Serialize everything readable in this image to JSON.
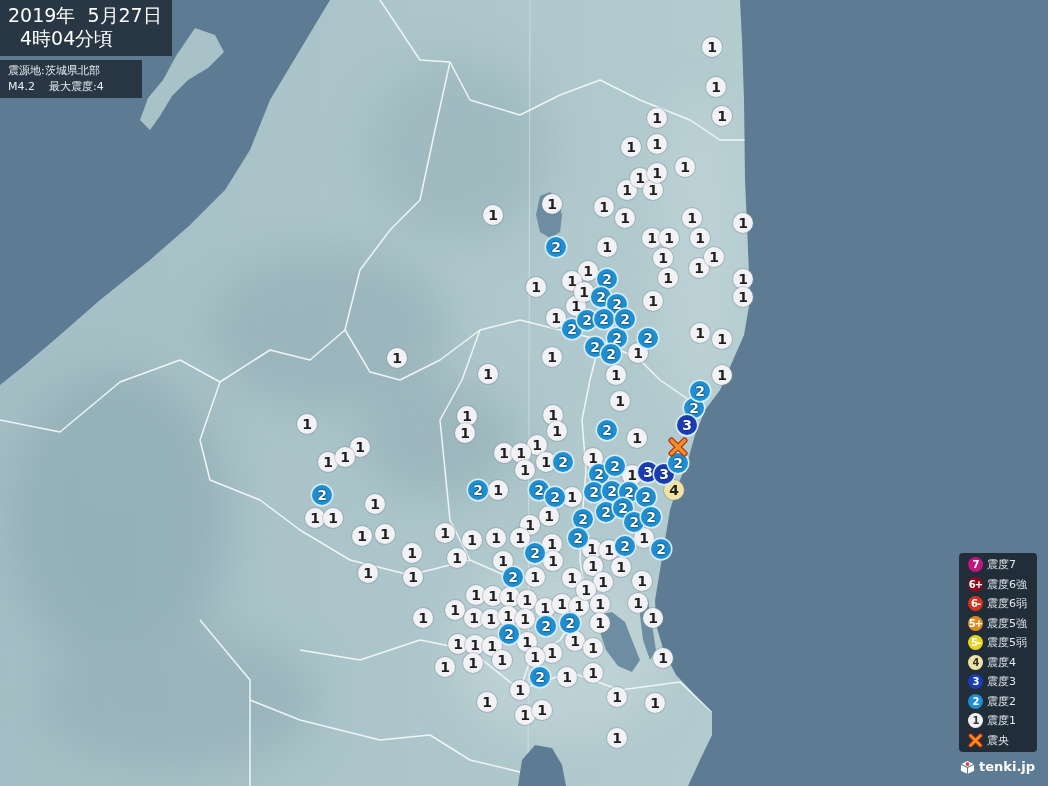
{
  "report": {
    "date": "2019年  5月27日",
    "time": "4時04分頃",
    "epicenter": "震源地:茨城県北部",
    "magnitude": "M4.2",
    "max_intensity": "最大震度:4"
  },
  "map": {
    "markers": [
      {
        "label": "1",
        "color": "#f2f2f6"
      },
      {
        "label": "1",
        "color": "#f2f2f6"
      },
      {
        "label": "1",
        "color": "#f2f2f6"
      },
      {
        "label": "1",
        "color": "#f2f2f6"
      },
      {
        "label": "1",
        "color": "#f2f2f6"
      },
      {
        "label": "1",
        "color": "#f2f2f6"
      },
      {
        "label": "1",
        "color": "#f2f2f6"
      },
      {
        "label": "1",
        "color": "#f2f2f6"
      },
      {
        "label": "1",
        "color": "#f2f2f6"
      },
      {
        "label": "1",
        "color": "#f2f2f6"
      },
      {
        "label": "1",
        "color": "#f2f2f6"
      },
      {
        "label": "1",
        "color": "#f2f2f6"
      },
      {
        "label": "1",
        "color": "#f2f2f6"
      },
      {
        "label": "1",
        "color": "#f2f2f6"
      },
      {
        "label": "1",
        "color": "#f2f2f6"
      },
      {
        "label": "1",
        "color": "#f2f2f6"
      },
      {
        "label": "1",
        "color": "#f2f2f6"
      },
      {
        "label": "2",
        "color": "#1d8fd2"
      },
      {
        "label": "1",
        "color": "#f2f2f6"
      },
      {
        "label": "1",
        "color": "#f2f2f6"
      },
      {
        "label": "1",
        "color": "#f2f2f6"
      },
      {
        "label": "1",
        "color": "#f2f2f6"
      },
      {
        "label": "1",
        "color": "#f2f2f6"
      },
      {
        "label": "1",
        "color": "#f2f2f6"
      },
      {
        "label": "1",
        "color": "#f2f2f6"
      },
      {
        "label": "1",
        "color": "#f2f2f6"
      },
      {
        "label": "1",
        "color": "#f2f2f6"
      },
      {
        "label": "1",
        "color": "#f2f2f6"
      },
      {
        "label": "2",
        "color": "#1d8fd2"
      },
      {
        "label": "1",
        "color": "#f2f2f6"
      },
      {
        "label": "1",
        "color": "#f2f2f6"
      },
      {
        "label": "1",
        "color": "#f2f2f6"
      },
      {
        "label": "1",
        "color": "#f2f2f6"
      },
      {
        "label": "2",
        "color": "#1d8fd2"
      },
      {
        "label": "2",
        "color": "#1d8fd2"
      },
      {
        "label": "1",
        "color": "#f2f2f6"
      },
      {
        "label": "1",
        "color": "#f2f2f6"
      },
      {
        "label": "1",
        "color": "#f2f2f6"
      },
      {
        "label": "2",
        "color": "#1d8fd2"
      },
      {
        "label": "2",
        "color": "#1d8fd2"
      },
      {
        "label": "2",
        "color": "#1d8fd2"
      },
      {
        "label": "2",
        "color": "#1d8fd2"
      },
      {
        "label": "2",
        "color": "#1d8fd2"
      },
      {
        "label": "2",
        "color": "#1d8fd2"
      },
      {
        "label": "2",
        "color": "#1d8fd2"
      },
      {
        "label": "1",
        "color": "#f2f2f6"
      },
      {
        "label": "1",
        "color": "#f2f2f6"
      },
      {
        "label": "1",
        "color": "#f2f2f6"
      },
      {
        "label": "1",
        "color": "#f2f2f6"
      },
      {
        "label": "2",
        "color": "#1d8fd2"
      },
      {
        "label": "1",
        "color": "#f2f2f6"
      },
      {
        "label": "1",
        "color": "#f2f2f6"
      },
      {
        "label": "1",
        "color": "#f2f2f6"
      },
      {
        "label": "1",
        "color": "#f2f2f6"
      },
      {
        "label": "1",
        "color": "#f2f2f6"
      },
      {
        "label": "2",
        "color": "#1d8fd2"
      },
      {
        "label": "2",
        "color": "#1d8fd2"
      },
      {
        "label": "1",
        "color": "#f2f2f6"
      },
      {
        "label": "1",
        "color": "#f2f2f6"
      },
      {
        "label": "1",
        "color": "#f2f2f6"
      },
      {
        "label": "1",
        "color": "#f2f2f6"
      },
      {
        "label": "1",
        "color": "#f2f2f6"
      },
      {
        "label": "2",
        "color": "#1d8fd2"
      },
      {
        "label": "3",
        "color": "#1a3db5"
      },
      {
        "label": "1",
        "color": "#f2f2f6"
      },
      {
        "label": "1",
        "color": "#f2f2f6"
      },
      {
        "label": "1",
        "color": "#f2f2f6"
      },
      {
        "label": "1",
        "color": "#f2f2f6"
      },
      {
        "label": "1",
        "color": "#f2f2f6"
      },
      {
        "label": "1",
        "color": "#f2f2f6"
      },
      {
        "label": "1",
        "color": "#f2f2f6"
      },
      {
        "label": "1",
        "color": "#f2f2f6"
      },
      {
        "label": "1",
        "color": "#f2f2f6"
      },
      {
        "label": "2",
        "color": "#1d8fd2"
      },
      {
        "label": "1",
        "color": "#f2f2f6"
      },
      {
        "label": "2",
        "color": "#1d8fd2"
      },
      {
        "label": "2",
        "color": "#1d8fd2"
      },
      {
        "label": "1",
        "color": "#f2f2f6"
      },
      {
        "label": "3",
        "color": "#1a3db5"
      },
      {
        "label": "3",
        "color": "#1a3db5"
      },
      {
        "label": "2",
        "color": "#1d8fd2"
      },
      {
        "label": "2",
        "color": "#1d8fd2"
      },
      {
        "label": "2",
        "color": "#1d8fd2"
      },
      {
        "label": "1",
        "color": "#f2f2f6"
      },
      {
        "label": "2",
        "color": "#1d8fd2"
      },
      {
        "label": "2",
        "color": "#1d8fd2"
      },
      {
        "label": "1",
        "color": "#f2f2f6"
      },
      {
        "label": "2",
        "color": "#1d8fd2"
      },
      {
        "label": "2",
        "color": "#1d8fd2"
      },
      {
        "label": "2",
        "color": "#1d8fd2"
      },
      {
        "label": "2",
        "color": "#1d8fd2"
      },
      {
        "label": "4",
        "color": "#f1e3a4"
      },
      {
        "label": "1",
        "color": "#f2f2f6"
      },
      {
        "label": "1",
        "color": "#f2f2f6"
      },
      {
        "label": "1",
        "color": "#f2f2f6"
      },
      {
        "label": "1",
        "color": "#f2f2f6"
      },
      {
        "label": "1",
        "color": "#f2f2f6"
      },
      {
        "label": "2",
        "color": "#1d8fd2"
      },
      {
        "label": "2",
        "color": "#1d8fd2"
      },
      {
        "label": "2",
        "color": "#1d8fd2"
      },
      {
        "label": "2",
        "color": "#1d8fd2"
      },
      {
        "label": "2",
        "color": "#1d8fd2"
      },
      {
        "label": "1",
        "color": "#f2f2f6"
      },
      {
        "label": "1",
        "color": "#f2f2f6"
      },
      {
        "label": "1",
        "color": "#f2f2f6"
      },
      {
        "label": "1",
        "color": "#f2f2f6"
      },
      {
        "label": "1",
        "color": "#f2f2f6"
      },
      {
        "label": "1",
        "color": "#f2f2f6"
      },
      {
        "label": "2",
        "color": "#1d8fd2"
      },
      {
        "label": "1",
        "color": "#f2f2f6"
      },
      {
        "label": "1",
        "color": "#f2f2f6"
      },
      {
        "label": "1",
        "color": "#f2f2f6"
      },
      {
        "label": "1",
        "color": "#f2f2f6"
      },
      {
        "label": "1",
        "color": "#f2f2f6"
      },
      {
        "label": "1",
        "color": "#f2f2f6"
      },
      {
        "label": "2",
        "color": "#1d8fd2"
      },
      {
        "label": "2",
        "color": "#1d8fd2"
      },
      {
        "label": "1",
        "color": "#f2f2f6"
      },
      {
        "label": "1",
        "color": "#f2f2f6"
      },
      {
        "label": "1",
        "color": "#f2f2f6"
      },
      {
        "label": "1",
        "color": "#f2f2f6"
      },
      {
        "label": "1",
        "color": "#f2f2f6"
      },
      {
        "label": "1",
        "color": "#f2f2f6"
      },
      {
        "label": "1",
        "color": "#f2f2f6"
      },
      {
        "label": "1",
        "color": "#f2f2f6"
      },
      {
        "label": "1",
        "color": "#f2f2f6"
      },
      {
        "label": "2",
        "color": "#1d8fd2"
      },
      {
        "label": "1",
        "color": "#f2f2f6"
      },
      {
        "label": "2",
        "color": "#1d8fd2"
      },
      {
        "label": "1",
        "color": "#f2f2f6"
      },
      {
        "label": "1",
        "color": "#f2f2f6"
      },
      {
        "label": "1",
        "color": "#f2f2f6"
      },
      {
        "label": "1",
        "color": "#f2f2f6"
      },
      {
        "label": "1",
        "color": "#f2f2f6"
      },
      {
        "label": "1",
        "color": "#f2f2f6"
      },
      {
        "label": "1",
        "color": "#f2f2f6"
      },
      {
        "label": "1",
        "color": "#f2f2f6"
      },
      {
        "label": "1",
        "color": "#f2f2f6"
      },
      {
        "label": "1",
        "color": "#f2f2f6"
      },
      {
        "label": "1",
        "color": "#f2f2f6"
      },
      {
        "label": "1",
        "color": "#f2f2f6"
      },
      {
        "label": "1",
        "color": "#f2f2f6"
      },
      {
        "label": "1",
        "color": "#f2f2f6"
      },
      {
        "label": "1",
        "color": "#f2f2f6"
      },
      {
        "label": "1",
        "color": "#f2f2f6"
      },
      {
        "label": "2",
        "color": "#1d8fd2"
      },
      {
        "label": "2",
        "color": "#1d8fd2"
      },
      {
        "label": "1",
        "color": "#f2f2f6"
      },
      {
        "label": "1",
        "color": "#f2f2f6"
      },
      {
        "label": "1",
        "color": "#f2f2f6"
      },
      {
        "label": "1",
        "color": "#f2f2f6"
      },
      {
        "label": "1",
        "color": "#f2f2f6"
      },
      {
        "label": "2",
        "color": "#1d8fd2"
      },
      {
        "label": "1",
        "color": "#f2f2f6"
      },
      {
        "label": "1",
        "color": "#f2f2f6"
      },
      {
        "label": "1",
        "color": "#f2f2f6"
      },
      {
        "label": "1",
        "color": "#f2f2f6"
      },
      {
        "label": "1",
        "color": "#f2f2f6"
      },
      {
        "label": "1",
        "color": "#f2f2f6"
      },
      {
        "label": "1",
        "color": "#f2f2f6"
      },
      {
        "label": "1",
        "color": "#f2f2f6"
      },
      {
        "label": "2",
        "color": "#1d8fd2"
      },
      {
        "label": "1",
        "color": "#f2f2f6"
      },
      {
        "label": "1",
        "color": "#f2f2f6"
      },
      {
        "label": "1",
        "color": "#f2f2f6"
      },
      {
        "label": "1",
        "color": "#f2f2f6"
      },
      {
        "label": "1",
        "color": "#f2f2f6"
      },
      {
        "label": "1",
        "color": "#f2f2f6"
      },
      {
        "label": "1",
        "color": "#f2f2f6"
      },
      {
        "label": "1",
        "color": "#f2f2f6"
      },
      {
        "label": "1",
        "color": "#f2f2f6"
      },
      {
        "label": "1",
        "color": "#f2f2f6"
      }
    ],
    "epicenter": {
      "color": "#f5901e"
    }
  },
  "legend": {
    "levels": [
      {
        "badge": "7",
        "label": "震度7",
        "color": "#c4147e"
      },
      {
        "badge": "6+",
        "label": "震度6強",
        "color": "#8c0a1e"
      },
      {
        "badge": "6-",
        "label": "震度6弱",
        "color": "#d8321c"
      },
      {
        "badge": "5+",
        "label": "震度5強",
        "color": "#e08a1c"
      },
      {
        "badge": "5-",
        "label": "震度5弱",
        "color": "#e6d41e"
      },
      {
        "badge": "4",
        "label": "震度4",
        "color": "#f1e3a4"
      },
      {
        "badge": "3",
        "label": "震度3",
        "color": "#1a3db5"
      },
      {
        "badge": "2",
        "label": "震度2",
        "color": "#1d8fd2"
      },
      {
        "badge": "1",
        "label": "震度1",
        "color": "#f2f2f6"
      }
    ],
    "epicenter": {
      "label": "震央",
      "color": "#f5901e"
    }
  },
  "brand": "tenki.jp"
}
